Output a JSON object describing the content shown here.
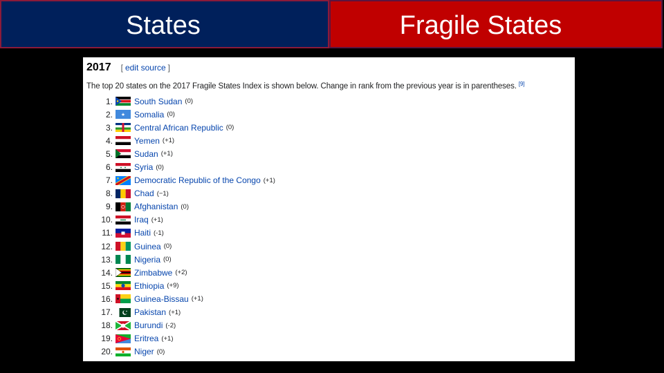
{
  "slide": {
    "header_left": "States",
    "header_right": "Fragile States",
    "colors": {
      "left": "#00205b",
      "right": "#c00000",
      "link": "#0645ad"
    }
  },
  "article": {
    "heading": "2017",
    "edit_open": "[",
    "edit_link": "edit source",
    "edit_close": "]",
    "intro": "The top 20 states on the 2017 Fragile States Index is shown below. Change in rank from the previous year is in parentheses.",
    "citation": "[9]",
    "list": [
      {
        "rank": "1.",
        "name": "South Sudan",
        "change": "(0)",
        "flag": "south-sudan"
      },
      {
        "rank": "2.",
        "name": "Somalia",
        "change": "(0)",
        "flag": "somalia"
      },
      {
        "rank": "3.",
        "name": "Central African Republic",
        "change": "(0)",
        "flag": "car"
      },
      {
        "rank": "4.",
        "name": "Yemen",
        "change": "(+1)",
        "flag": "yemen"
      },
      {
        "rank": "5.",
        "name": "Sudan",
        "change": "(+1)",
        "flag": "sudan"
      },
      {
        "rank": "6.",
        "name": "Syria",
        "change": "(0)",
        "flag": "syria"
      },
      {
        "rank": "7.",
        "name": "Democratic Republic of the Congo",
        "change": "(+1)",
        "flag": "drc"
      },
      {
        "rank": "8.",
        "name": "Chad",
        "change": "(−1)",
        "flag": "chad"
      },
      {
        "rank": "9.",
        "name": "Afghanistan",
        "change": "(0)",
        "flag": "afghanistan"
      },
      {
        "rank": "10.",
        "name": "Iraq",
        "change": "(+1)",
        "flag": "iraq"
      },
      {
        "rank": "11.",
        "name": "Haiti",
        "change": "(-1)",
        "flag": "haiti"
      },
      {
        "rank": "12.",
        "name": "Guinea",
        "change": "(0)",
        "flag": "guinea"
      },
      {
        "rank": "13.",
        "name": "Nigeria",
        "change": "(0)",
        "flag": "nigeria"
      },
      {
        "rank": "14.",
        "name": "Zimbabwe",
        "change": "(+2)",
        "flag": "zimbabwe"
      },
      {
        "rank": "15.",
        "name": "Ethiopia",
        "change": "(+9)",
        "flag": "ethiopia"
      },
      {
        "rank": "16.",
        "name": "Guinea-Bissau",
        "change": "(+1)",
        "flag": "guinea-bissau"
      },
      {
        "rank": "17.",
        "name": "Pakistan",
        "change": "(+1)",
        "flag": "pakistan"
      },
      {
        "rank": "18.",
        "name": "Burundi",
        "change": "(-2)",
        "flag": "burundi"
      },
      {
        "rank": "19.",
        "name": "Eritrea",
        "change": "(+1)",
        "flag": "eritrea"
      },
      {
        "rank": "20.",
        "name": "Niger",
        "change": "(0)",
        "flag": "niger"
      }
    ]
  }
}
